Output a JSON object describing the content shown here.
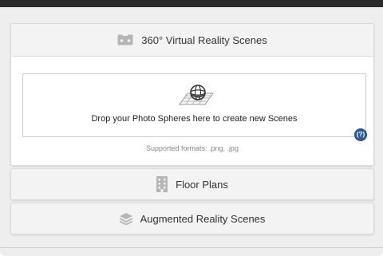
{
  "sections": {
    "vr_scenes": {
      "title": "360° Virtual Reality Scenes",
      "icon": "vr-headset-icon",
      "dropzone": {
        "message": "Drop your Photo Spheres here to create new Scenes",
        "icon": "photo-sphere-icon"
      },
      "help_label": "(?)",
      "supported_formats": "Supported formats: .png, .jpg"
    },
    "floor_plans": {
      "title": "Floor Plans",
      "icon": "building-icon"
    },
    "ar_scenes": {
      "title": "Augmented Reality Scenes",
      "icon": "layers-icon"
    }
  },
  "colors": {
    "help_badge": "#2d5e9a",
    "panel_bg": "#f3f3f3",
    "icon_gray": "#b5b5b5",
    "text": "#333333"
  }
}
